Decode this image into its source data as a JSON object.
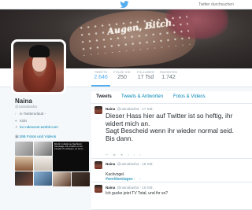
{
  "topbar": {
    "logo_icon": "twitter-bird-icon",
    "search_placeholder": "Twitter durchsuchen"
  },
  "banner": {
    "text": "Augen, Bitch"
  },
  "stats": [
    {
      "label": "TWEETS",
      "value": "2.646"
    },
    {
      "label": "FOLGE ICH",
      "value": "250"
    },
    {
      "label": "FOLLOWER",
      "value": "17 Tsd"
    },
    {
      "label": "FAVORITEN",
      "value": "1.742"
    }
  ],
  "profile": {
    "name": "Naina",
    "handle": "@nainabasha",
    "bio": "in Twitterurlaub -",
    "location": "Köln",
    "website": "inc-ndescent.tumblr.com",
    "media_label": "266 Fotos und Videos",
    "thumb_caption": "Mit dir in Zeitzone Nachtzeit Samstags, Alt, einfach so ins Fenster zu schauen, es ist so"
  },
  "tabs": [
    {
      "label": "Tweets"
    },
    {
      "label": "Tweets & Antworten"
    },
    {
      "label": "Fotos & Videos"
    }
  ],
  "tweets": [
    {
      "name": "Naina",
      "handle": "@nainabasha",
      "time": "17 Std.",
      "text": "Dieser Hass hier auf Twitter ist so heftig, ihr widert mich an.\nSagt Bescheid wenn ihr wieder normal seid.\nBis dann."
    },
    {
      "name": "Naina",
      "handle": "@nainabasha",
      "time": "18 Std.",
      "text": "Kackvogel.",
      "hashtag": "#worldsestages"
    },
    {
      "name": "Naina",
      "handle": "@nainabasha",
      "time": "18 Std.",
      "text": "Ich gucke jetzt TV Total, und ihr so?"
    }
  ],
  "colors": {
    "accent": "#55acee",
    "link": "#0084b4",
    "text": "#292f33",
    "muted": "#8899a6"
  }
}
